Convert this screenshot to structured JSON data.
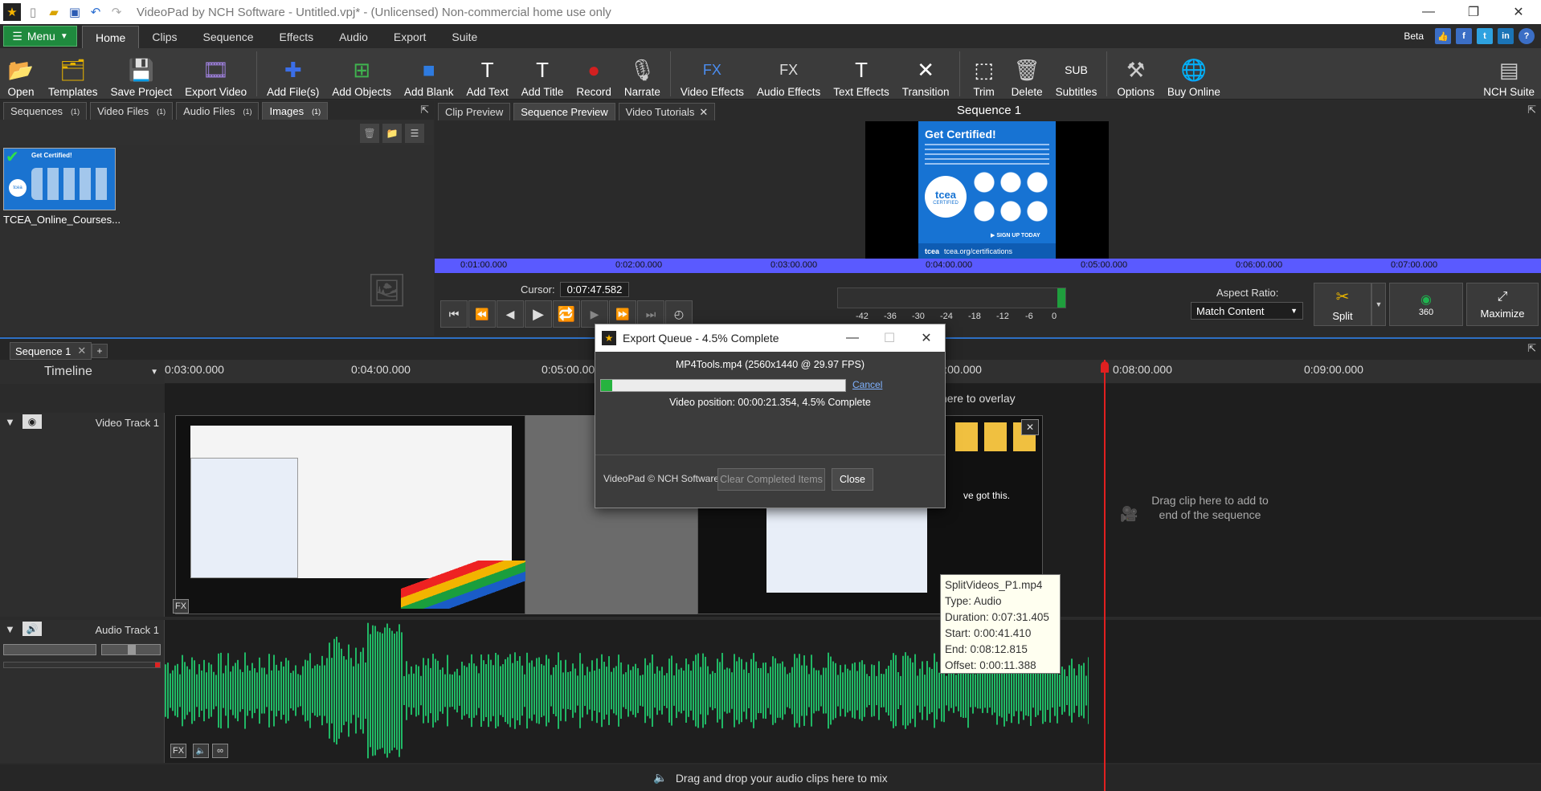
{
  "app": {
    "title": "VideoPad by NCH Software - Untitled.vpj* - (Unlicensed) Non-commercial home use only"
  },
  "ribbon": {
    "menu_label": "Menu",
    "tabs": [
      "Home",
      "Clips",
      "Sequence",
      "Effects",
      "Audio",
      "Export",
      "Suite"
    ],
    "beta_label": "Beta"
  },
  "toolbar": {
    "items": [
      {
        "label": "Open",
        "icon": "folder-open-icon"
      },
      {
        "label": "Templates",
        "icon": "templates-icon"
      },
      {
        "label": "Save Project",
        "icon": "save-project-icon"
      },
      {
        "label": "Export Video",
        "icon": "export-video-icon"
      },
      {
        "label": "Add File(s)",
        "icon": "add-files-icon"
      },
      {
        "label": "Add Objects",
        "icon": "add-objects-icon"
      },
      {
        "label": "Add Blank",
        "icon": "add-blank-icon"
      },
      {
        "label": "Add Text",
        "icon": "add-text-icon"
      },
      {
        "label": "Add Title",
        "icon": "add-title-icon"
      },
      {
        "label": "Record",
        "icon": "record-icon"
      },
      {
        "label": "Narrate",
        "icon": "microphone-icon"
      },
      {
        "label": "Video Effects",
        "icon": "video-effects-icon"
      },
      {
        "label": "Audio Effects",
        "icon": "audio-effects-icon"
      },
      {
        "label": "Text Effects",
        "icon": "text-effects-icon"
      },
      {
        "label": "Transition",
        "icon": "transition-icon"
      },
      {
        "label": "Trim",
        "icon": "trim-icon"
      },
      {
        "label": "Delete",
        "icon": "trash-icon"
      },
      {
        "label": "Subtitles",
        "icon": "subtitles-icon"
      },
      {
        "label": "Options",
        "icon": "options-icon"
      },
      {
        "label": "Buy Online",
        "icon": "globe-icon"
      }
    ],
    "suite_label": "NCH Suite"
  },
  "bins": {
    "tabs": [
      {
        "label": "Sequences",
        "count": "(1)"
      },
      {
        "label": "Video Files",
        "count": "(1)"
      },
      {
        "label": "Audio Files",
        "count": "(1)"
      },
      {
        "label": "Images",
        "count": "(1)"
      }
    ],
    "thumb_label": "TCEA_Online_Courses...",
    "thumb_heading": "Get Certified!",
    "thumb_brand": "tcea"
  },
  "preview": {
    "tabs": [
      "Clip Preview",
      "Sequence Preview",
      "Video Tutorials"
    ],
    "title": "Sequence 1",
    "image_heading": "Get Certified!",
    "image_badge": "tcea",
    "image_badge_sub": "CERTIFIED",
    "image_cta": "▶ SIGN UP TODAY",
    "image_footer": "tcea.org/certifications",
    "ruler": [
      "0:01:00.000",
      "0:02:00.000",
      "0:03:00.000",
      "0:04:00.000",
      "0:05:00.000",
      "0:06:00.000",
      "0:07:00.000"
    ],
    "cursor_label": "Cursor:",
    "cursor_value": "0:07:47.582",
    "meter_labels": [
      "-42",
      "-36",
      "-30",
      "-24",
      "-18",
      "-12",
      "-6",
      "0"
    ],
    "aspect_label": "Aspect Ratio:",
    "aspect_value": "Match Content",
    "split_label": "Split",
    "vr_label": "360",
    "maximize_label": "Maximize"
  },
  "timeline": {
    "sequence_tab": "Sequence 1",
    "timeline_label": "Timeline",
    "ruler": [
      "0:03:00.000",
      "0:04:00.000",
      "0:05:00.000",
      "0:07:00.000",
      "0:08:00.000",
      "0:09:00.000"
    ],
    "overlay_hint": "here to overlay",
    "video_track": "Video Track 1",
    "audio_track": "Audio Track 1",
    "end_hint": "Drag clip here to add to end of the sequence",
    "audio_drop_hint": "Drag and drop your audio clips here to mix",
    "fx_label": "FX",
    "clip_text": "ve got this."
  },
  "export_dialog": {
    "title": "Export Queue - 4.5% Complete",
    "file": "MP4Tools.mp4 (2560x1440 @ 29.97 FPS)",
    "progress": 4.5,
    "cancel": "Cancel",
    "position": "Video position:  00:00:21.354, 4.5% Complete",
    "copyright": "VideoPad © NCH Software",
    "clear_button": "Clear Completed Items",
    "close_button": "Close"
  },
  "tooltip": {
    "lines": [
      "SplitVideos_P1.mp4",
      "Type: Audio",
      "Duration: 0:07:31.405",
      "Start: 0:00:41.410",
      "End: 0:08:12.815",
      "Offset: 0:00:11.388"
    ]
  }
}
